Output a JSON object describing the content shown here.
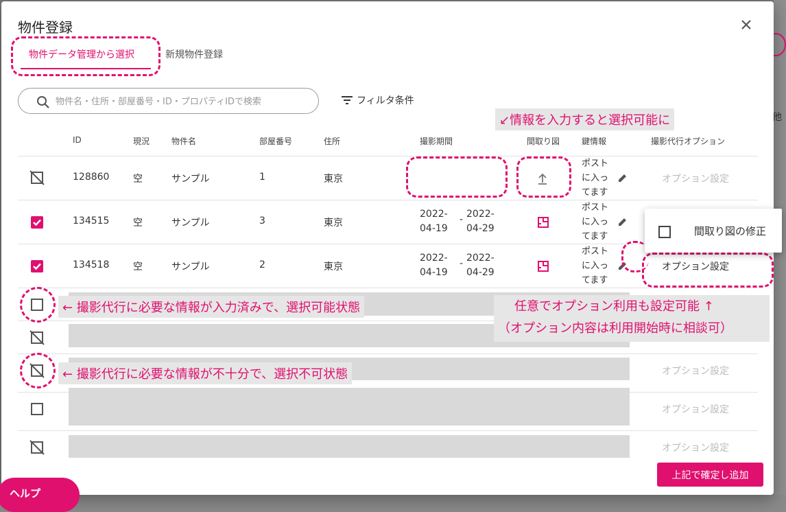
{
  "dialog": {
    "title": "物件登録",
    "tabs": [
      {
        "label": "物件データ管理から選択"
      },
      {
        "label": "新規物件登録"
      }
    ]
  },
  "search": {
    "placeholder": "物件名・住所・部屋番号・ID・プロパティIDで検索"
  },
  "filter": {
    "label": "フィルタ条件"
  },
  "table": {
    "headers": [
      "ID",
      "現況",
      "物件名",
      "部屋番号",
      "住所",
      "撮影期間",
      "間取り図",
      "鍵情報",
      "撮影代行オプション"
    ],
    "rows": [
      {
        "id": "128860",
        "status": "空",
        "name": "サンプル",
        "room": "1",
        "address": "東京",
        "period_start": "",
        "period_end": "",
        "floorplan": "upload-icon",
        "key": "ポストに入ってます",
        "option": "オプション設定",
        "checkbox": "disabled"
      },
      {
        "id": "134515",
        "status": "空",
        "name": "サンプル",
        "room": "3",
        "address": "東京",
        "period_start": "2022-04-19",
        "period_end": "2022-04-29",
        "floorplan": "floorplan-icon",
        "key": "ポストに入ってます",
        "option": "",
        "checkbox": "checked"
      },
      {
        "id": "134518",
        "status": "空",
        "name": "サンプル",
        "room": "2",
        "address": "東京",
        "period_start": "2022-04-19",
        "period_end": "2022-04-29",
        "floorplan": "floorplan-icon",
        "key": "ポストに入ってます",
        "option": "オプション設定",
        "checkbox": "checked"
      },
      {
        "checkbox": "unchecked",
        "option": ""
      },
      {
        "checkbox": "disabled",
        "option": ""
      },
      {
        "checkbox": "disabled",
        "option": "オプション設定"
      },
      {
        "checkbox": "unchecked",
        "option": "オプション設定"
      },
      {
        "checkbox": "disabled",
        "option": "オプション設定"
      }
    ],
    "date_separator": "-"
  },
  "option_menu": {
    "item": "間取り図の修正"
  },
  "annotations": {
    "enter_info": "↙情報を入力すると選択可能に",
    "selectable": "← 撮影代行に必要な情報が入力済みで、選択可能状態",
    "not_selectable": "← 撮影代行に必要な情報が不十分で、選択不可状態",
    "option_line1": "任意でオプション利用も設定可能 ↑",
    "option_line2": "（オプション内容は利用開始時に相談可）"
  },
  "footer": {
    "submit_label": "上記で確定し追加",
    "help_label": "ヘルプ"
  },
  "colors": {
    "accent": "#e0106f",
    "masked": "#d9d9d9"
  }
}
